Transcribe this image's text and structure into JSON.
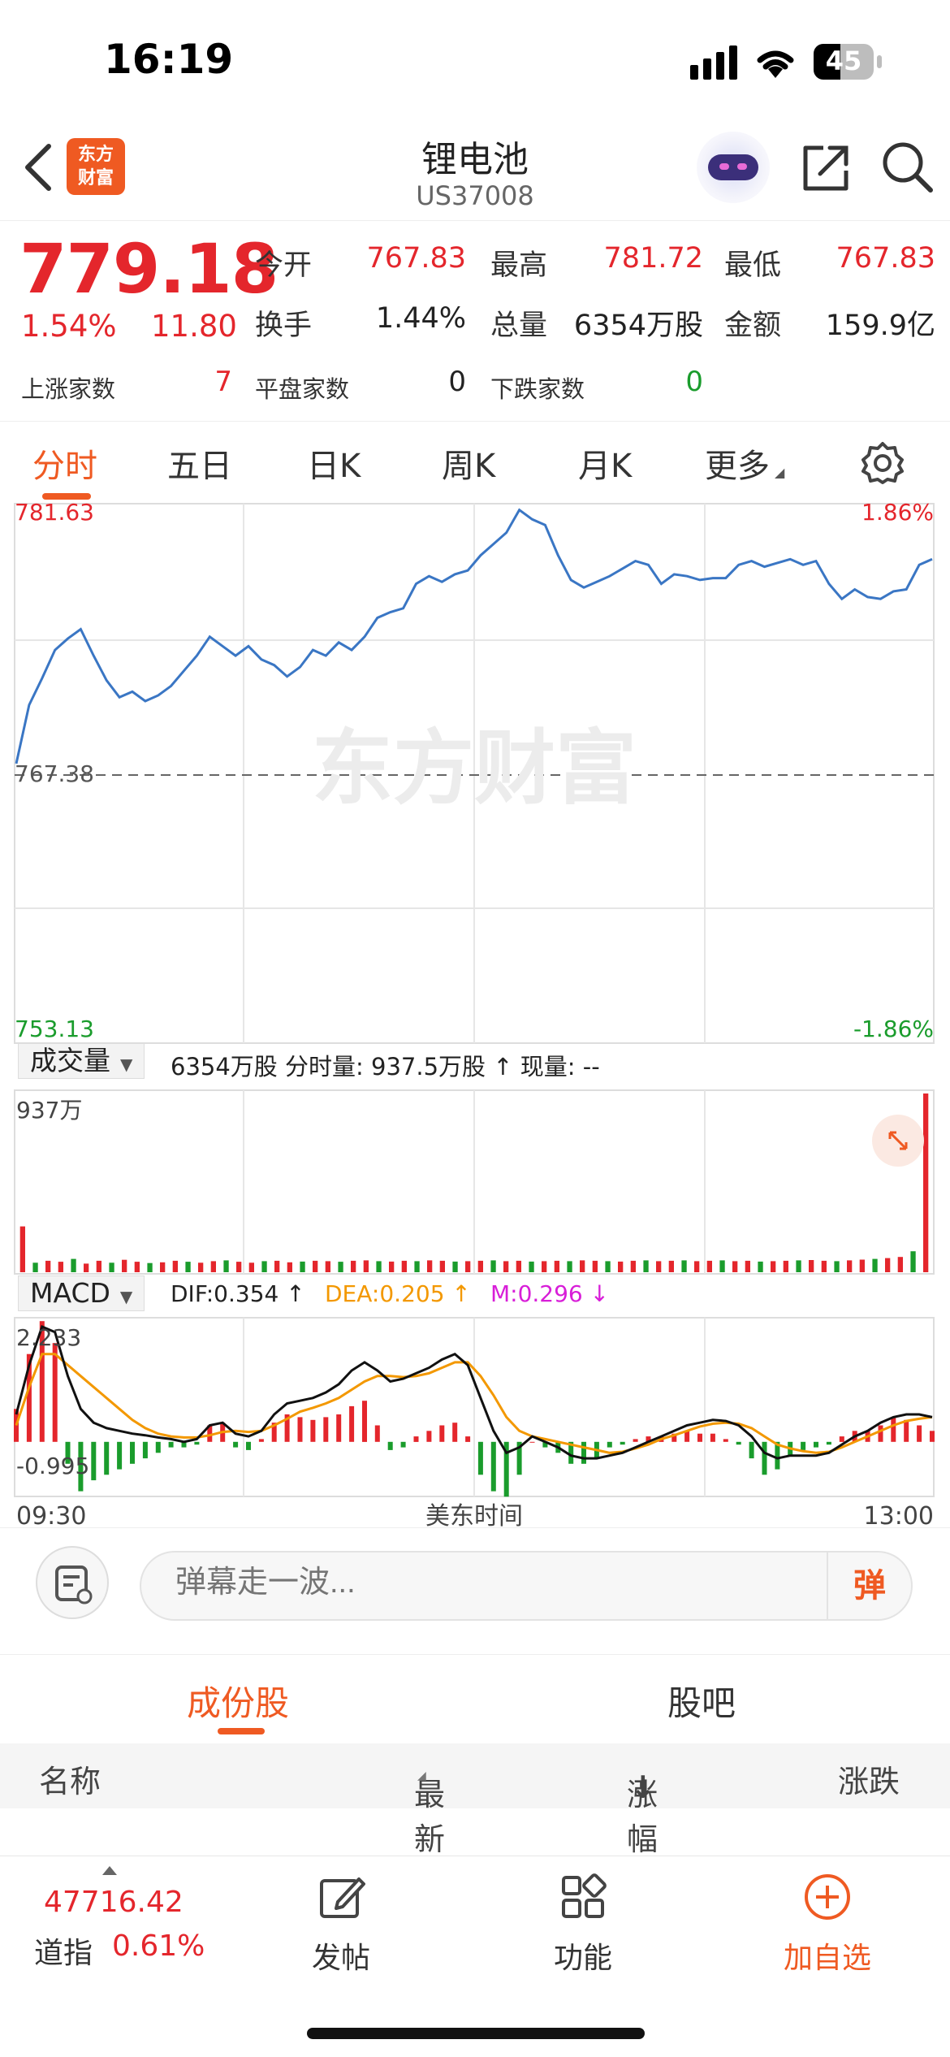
{
  "status_bar": {
    "time": "16:19",
    "battery": "45"
  },
  "header": {
    "logo_text": "东方\n财富",
    "title": "锂电池",
    "code": "US37008"
  },
  "quote": {
    "price": "779.18",
    "change_pct": "1.54%",
    "change": "11.80",
    "open_label": "今开",
    "open": "767.83",
    "high_label": "最高",
    "high": "781.72",
    "low_label": "最低",
    "low": "767.83",
    "turnover_label": "换手",
    "turnover": "1.44%",
    "volume_label": "总量",
    "volume": "6354万股",
    "amount_label": "金额",
    "amount": "159.9亿",
    "up_label": "上涨家数",
    "up": "7",
    "flat_label": "平盘家数",
    "flat": "0",
    "down_label": "下跌家数",
    "down": "0"
  },
  "tabs": [
    "分时",
    "五日",
    "日K",
    "周K",
    "月K",
    "更多"
  ],
  "chart_data": [
    {
      "type": "line",
      "y_axis_labels": {
        "top": "781.63",
        "mid": "767.38",
        "bottom": "753.13",
        "top_pct": "1.86%",
        "bottom_pct": "-1.86%"
      },
      "ylim": [
        753.13,
        781.63
      ],
      "reference": 767.38,
      "series": [
        {
          "values": [
            767.9,
            771.0,
            772.4,
            773.9,
            774.5,
            775.0,
            773.6,
            772.3,
            771.4,
            771.7,
            771.2,
            771.5,
            772.0,
            772.8,
            773.6,
            774.6,
            774.1,
            773.6,
            774.1,
            773.4,
            773.1,
            772.5,
            773.0,
            773.9,
            773.6,
            774.3,
            773.9,
            774.6,
            775.6,
            775.9,
            776.1,
            777.4,
            777.8,
            777.5,
            777.9,
            778.1,
            778.9,
            779.5,
            780.1,
            781.3,
            780.8,
            780.5,
            778.9,
            777.6,
            777.2,
            777.5,
            777.8,
            778.2,
            778.6,
            778.4,
            777.4,
            777.9,
            777.8,
            777.6,
            777.7,
            777.7,
            778.4,
            778.6,
            778.3,
            778.5,
            778.7,
            778.4,
            778.6,
            777.4,
            776.6,
            777.1,
            776.7,
            776.6,
            777.0,
            777.1,
            778.4,
            778.7
          ]
        }
      ],
      "watermark": "东方财富"
    },
    {
      "type": "bar",
      "label": "成交量",
      "summary": "6354万股 分时量: 937.5万股 ↑ 现量: --",
      "ymax_label": "937万",
      "values": [
        240,
        50,
        60,
        55,
        70,
        45,
        60,
        50,
        65,
        55,
        48,
        52,
        60,
        55,
        50,
        58,
        62,
        55,
        50,
        58,
        60,
        52,
        56,
        60,
        58,
        55,
        60,
        62,
        58,
        56,
        60,
        58,
        62,
        60,
        56,
        58,
        60,
        62,
        58,
        60,
        56,
        58,
        60,
        58,
        62,
        60,
        58,
        56,
        60,
        62,
        58,
        60,
        62,
        58,
        60,
        62,
        58,
        60,
        56,
        58,
        60,
        62,
        64,
        60,
        58,
        62,
        66,
        70,
        74,
        80,
        110,
        937
      ]
    },
    {
      "type": "line",
      "label": "MACD",
      "dif": "DIF:0.354 ↑",
      "dea": "DEA:0.205 ↑",
      "m": "M:0.296 ↓",
      "ymax_label": "2.233",
      "ymin_label": "-0.995",
      "ylim": [
        -0.995,
        2.233
      ],
      "x_labels": {
        "start": "09:30",
        "mid": "美东时间",
        "end": "13:00"
      },
      "dif_values": [
        0.5,
        1.4,
        2.1,
        2.0,
        1.2,
        0.6,
        0.35,
        0.25,
        0.2,
        0.15,
        0.12,
        0.08,
        0.05,
        0.0,
        0.05,
        0.3,
        0.35,
        0.15,
        0.1,
        0.2,
        0.5,
        0.7,
        0.75,
        0.8,
        0.9,
        1.05,
        1.3,
        1.45,
        1.3,
        1.1,
        1.15,
        1.25,
        1.35,
        1.5,
        1.6,
        1.4,
        0.8,
        0.2,
        -0.2,
        -0.1,
        0.1,
        0.0,
        -0.1,
        -0.25,
        -0.3,
        -0.3,
        -0.25,
        -0.2,
        -0.1,
        0.0,
        0.1,
        0.2,
        0.3,
        0.35,
        0.4,
        0.38,
        0.3,
        0.1,
        -0.2,
        -0.3,
        -0.25,
        -0.25,
        -0.25,
        -0.2,
        -0.05,
        0.1,
        0.2,
        0.35,
        0.45,
        0.5,
        0.5,
        0.45
      ],
      "dea_values": [
        0.3,
        1.0,
        1.6,
        1.6,
        1.4,
        1.2,
        1.0,
        0.8,
        0.6,
        0.4,
        0.25,
        0.15,
        0.1,
        0.08,
        0.08,
        0.12,
        0.18,
        0.2,
        0.18,
        0.2,
        0.3,
        0.42,
        0.55,
        0.62,
        0.7,
        0.8,
        0.95,
        1.1,
        1.2,
        1.2,
        1.18,
        1.2,
        1.25,
        1.35,
        1.45,
        1.45,
        1.2,
        0.85,
        0.45,
        0.2,
        0.1,
        0.05,
        0.0,
        -0.05,
        -0.1,
        -0.15,
        -0.2,
        -0.18,
        -0.12,
        -0.05,
        0.05,
        0.12,
        0.2,
        0.28,
        0.33,
        0.35,
        0.33,
        0.25,
        0.1,
        -0.05,
        -0.12,
        -0.17,
        -0.2,
        -0.18,
        -0.1,
        0.0,
        0.1,
        0.2,
        0.3,
        0.38,
        0.42,
        0.45
      ],
      "m_values": [
        0.6,
        1.6,
        2.2,
        1.8,
        -0.4,
        -0.9,
        -0.7,
        -0.6,
        -0.5,
        -0.4,
        -0.3,
        -0.2,
        -0.1,
        -0.1,
        -0.05,
        0.3,
        0.35,
        -0.1,
        -0.15,
        0.05,
        0.35,
        0.5,
        0.45,
        0.4,
        0.45,
        0.5,
        0.65,
        0.75,
        0.3,
        -0.15,
        -0.1,
        0.1,
        0.2,
        0.3,
        0.35,
        0.1,
        -0.6,
        -0.9,
        -1.0,
        -0.6,
        0.0,
        -0.1,
        -0.2,
        -0.4,
        -0.4,
        -0.3,
        -0.1,
        -0.05,
        0.05,
        0.1,
        0.1,
        0.15,
        0.2,
        0.15,
        0.15,
        0.05,
        -0.05,
        -0.3,
        -0.6,
        -0.5,
        -0.25,
        -0.15,
        -0.1,
        -0.05,
        0.1,
        0.2,
        0.2,
        0.3,
        0.45,
        0.4,
        0.3,
        0.2
      ]
    }
  ],
  "comment": {
    "placeholder": "弹幕走一波...",
    "send": "弹"
  },
  "sub_tabs": [
    "成份股",
    "股吧"
  ],
  "table": {
    "col_name": "名称",
    "col_latest": "最新",
    "col_pct": "涨幅",
    "col_change": "涨跌"
  },
  "bottom": {
    "index_value": "47716.42",
    "index_name": "道指",
    "index_pct": "0.61%",
    "post_label": "发帖",
    "func_label": "功能",
    "add_label": "加自选"
  },
  "colors": {
    "accent": "#ef5a22",
    "up": "#e4262c",
    "down": "#1a9c2c",
    "line": "#3a76c4",
    "dif": "#111111",
    "dea": "#f39800",
    "m": "#d81ed8"
  }
}
